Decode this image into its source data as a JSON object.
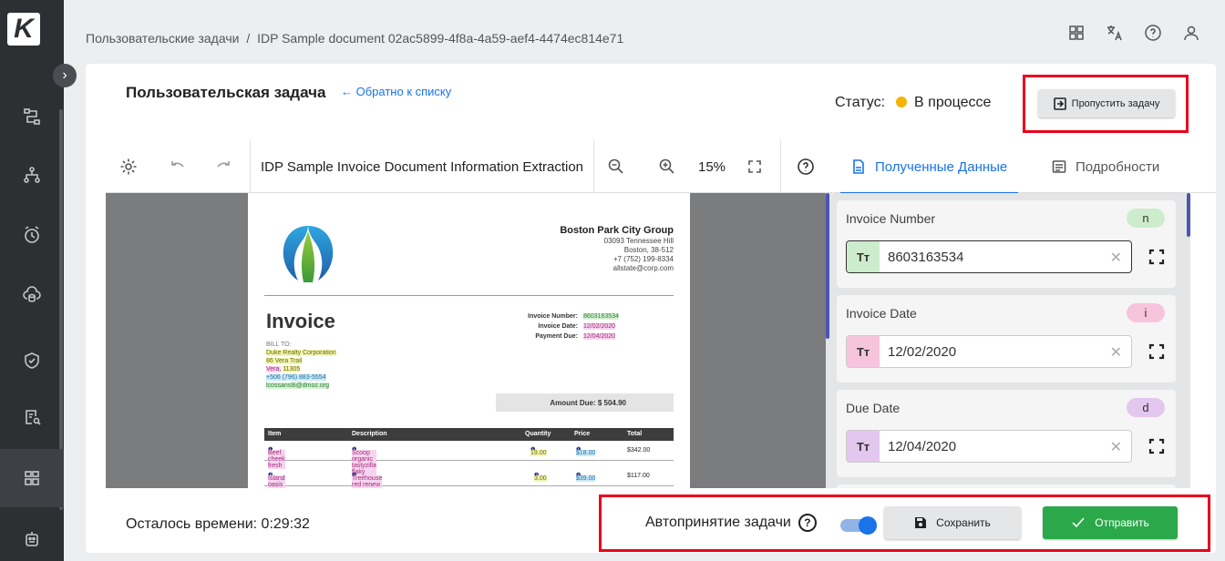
{
  "app": {
    "logo_letter": "K"
  },
  "breadcrumb": {
    "parent": "Пользовательские задачи",
    "separator": "/",
    "current": "IDP Sample document 02ac5899-4f8a-4a59-aef4-4474ec814e71"
  },
  "task": {
    "title": "Пользовательская задача",
    "back_link": "← Обратно к списку",
    "status_label": "Статус:",
    "status_value": "В процессе",
    "status_color": "#f4b400",
    "skip_button": "Пропустить задачу"
  },
  "viewer": {
    "document_title": "IDP Sample Invoice Document Information Extraction",
    "zoom": "15%"
  },
  "invoice": {
    "company_name": "Boston Park City Group",
    "company_address": [
      "03093 Tennessee Hill",
      "Boston, 38-512",
      "+7 (752) 199-8334",
      "allstate@corp.com"
    ],
    "heading": "Invoice",
    "bill_to_label": "BILL TO:",
    "bill_to_company": "Duke Realty Corporation",
    "bill_to_street": "86 Vera Trail",
    "bill_to_city": "Vera,",
    "bill_to_zip": "11305",
    "bill_to_phone": "+506 (796) 883-5554",
    "bill_to_email": "lcossans8i@dmoz.org",
    "invoice_number_label": "Invoice Number:",
    "invoice_number": "8603163534",
    "invoice_date_label": "Invoice Date:",
    "invoice_date": "12/02/2020",
    "payment_due_label": "Payment Due:",
    "payment_due": "12/04/2020",
    "amount_due_label": "Amount Due:",
    "amount_due": "$ 504.90",
    "columns": [
      "Item",
      "Description",
      "Quantity",
      "Price",
      "Total"
    ],
    "rows": [
      {
        "item": "Beef cheek fresh",
        "item_mark": "❶",
        "description": "Scoop organic tastyzilla flaky fresh",
        "desc_mark": "❶",
        "quantity": "19.00",
        "qty_mark": "❶",
        "price": "$18.00",
        "price_mark": "❶",
        "total": "$342.00"
      },
      {
        "item": "Island oasis",
        "item_mark": "❷",
        "description": "Treehouse red renew food brew healthy",
        "desc_mark": "❷",
        "quantity": "3.00",
        "qty_mark": "❷",
        "price": "$39.00",
        "price_mark": "❷",
        "total": "$117.00"
      }
    ]
  },
  "right_panel": {
    "tab_extracted": "Полученные Данные",
    "tab_details": "Подробности",
    "fields": [
      {
        "label": "Invoice Number",
        "badge": "n",
        "badge_color": "#cdeccd",
        "type_icon": "Tт",
        "type_bg": "#cdeccd",
        "value": "8603163534"
      },
      {
        "label": "Invoice Date",
        "badge": "i",
        "badge_color": "#f7c4de",
        "type_icon": "Tт",
        "type_bg": "#f7c4de",
        "value": "12/02/2020"
      },
      {
        "label": "Due Date",
        "badge": "d",
        "badge_color": "#e3c7ee",
        "type_icon": "Tт",
        "type_bg": "#e3c7ee",
        "value": "12/04/2020"
      }
    ]
  },
  "footer": {
    "time_left": "Осталось времени: 0:29:32",
    "auto_accept_label": "Автопринятие задачи",
    "auto_accept_on": true,
    "save_button": "Сохранить",
    "send_button": "Отправить",
    "accent_color": "#1a73e8",
    "send_color": "#2aa84a",
    "highlight_color": "#e8001c"
  }
}
